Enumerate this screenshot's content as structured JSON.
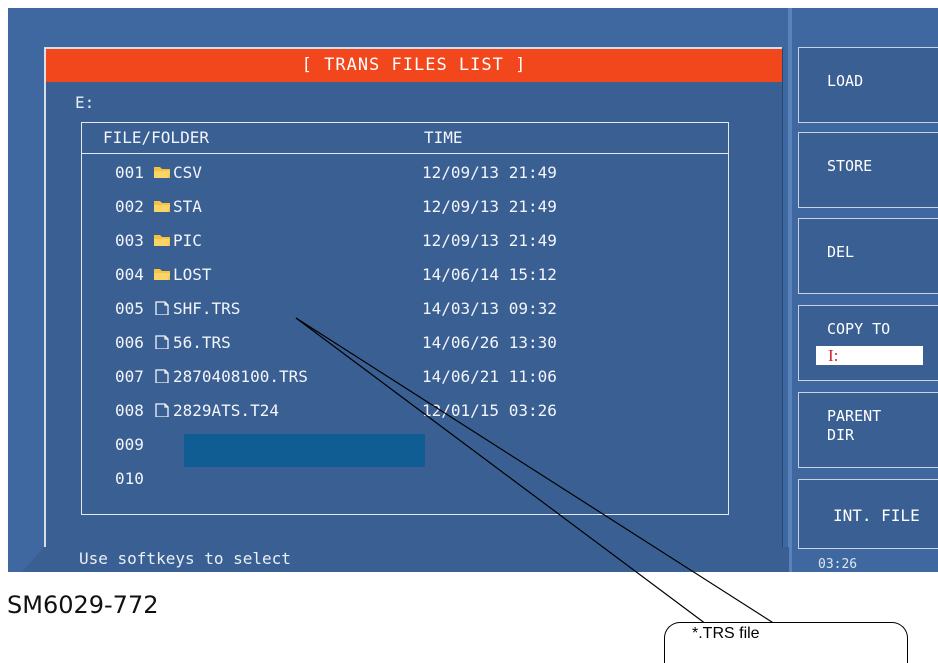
{
  "title": "[ TRANS FILES LIST ]",
  "current_path": "E:",
  "columns": {
    "name": "FILE/FOLDER",
    "time": "TIME"
  },
  "rows": [
    {
      "num": "001",
      "type": "folder",
      "name": "CSV",
      "time": "12/09/13 21:49"
    },
    {
      "num": "002",
      "type": "folder",
      "name": "STA",
      "time": "12/09/13 21:49"
    },
    {
      "num": "003",
      "type": "folder",
      "name": "PIC",
      "time": "12/09/13 21:49"
    },
    {
      "num": "004",
      "type": "folder",
      "name": "LOST",
      "time": "14/06/14 15:12"
    },
    {
      "num": "005",
      "type": "file",
      "name": "SHF.TRS",
      "time": "14/03/13 09:32"
    },
    {
      "num": "006",
      "type": "file",
      "name": "56.TRS",
      "time": "14/06/26 13:30"
    },
    {
      "num": "007",
      "type": "file",
      "name": "2870408100.TRS",
      "time": "14/06/21 11:06"
    },
    {
      "num": "008",
      "type": "file",
      "name": "2829ATS.T24",
      "time": "12/01/15 03:26"
    },
    {
      "num": "009",
      "type": "empty",
      "name": "",
      "time": ""
    },
    {
      "num": "010",
      "type": "empty",
      "name": "",
      "time": ""
    }
  ],
  "status_text": "Use softkeys to select",
  "softkeys": {
    "load": "LOAD",
    "store": "STORE",
    "del": "DEL",
    "copy_to": "COPY TO",
    "copy_to_value": "I:",
    "parent_dir_line1": "PARENT",
    "parent_dir_line2": "DIR",
    "int_file": "INT. FILE"
  },
  "clock": "03:26",
  "caption": "SM6029-772",
  "callout": "*.TRS file",
  "colors": {
    "screen_bg": "#3f68a0",
    "title_bar": "#f2461c",
    "highlight": "#0f5d93",
    "folder": "#f5c242"
  }
}
